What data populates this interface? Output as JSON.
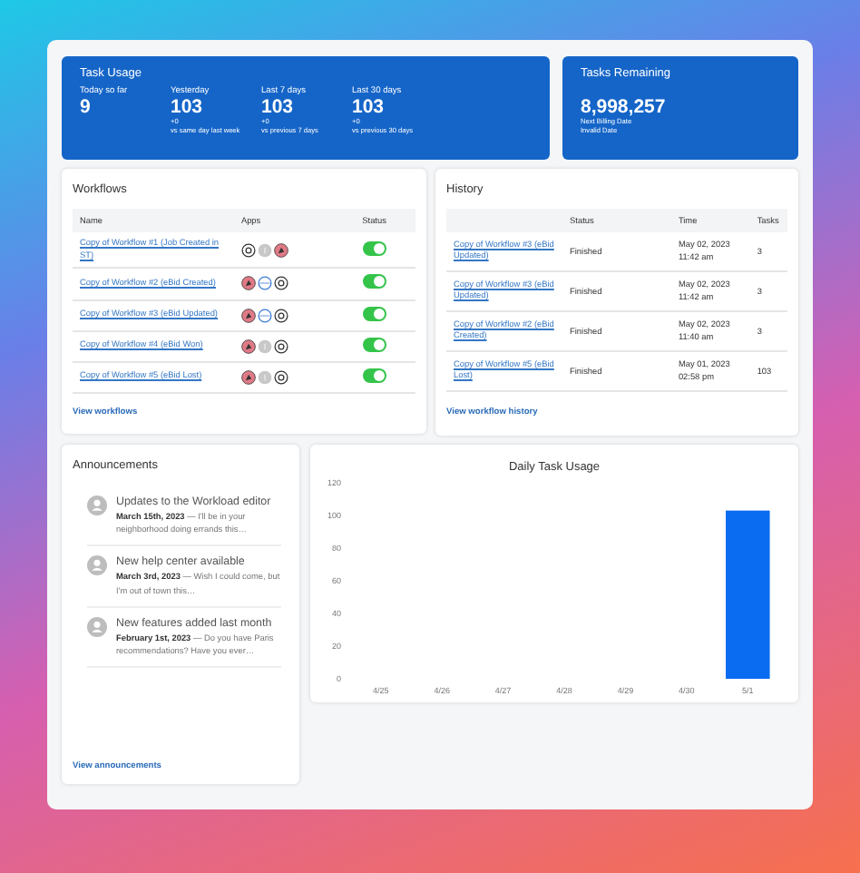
{
  "task_usage": {
    "title": "Task Usage",
    "stats": [
      {
        "label": "Today so far",
        "value": "9"
      },
      {
        "label": "Yesterday",
        "value": "103",
        "change": "+0",
        "compare": "vs same day last week"
      },
      {
        "label": "Last 7 days",
        "value": "103",
        "change": "+0",
        "compare": "vs previous 7 days"
      },
      {
        "label": "Last 30 days",
        "value": "103",
        "change": "+0",
        "compare": "vs previous 30 days"
      }
    ]
  },
  "tasks_remaining": {
    "title": "Tasks Remaining",
    "value": "8,998,257",
    "label": "Next Billing Date",
    "date": "Invalid Date"
  },
  "workflows": {
    "title": "Workflows",
    "columns": [
      "Name",
      "Apps",
      "Status"
    ],
    "rows": [
      {
        "name": "Copy of Workflow #1 (Job Created in ST)",
        "apps": [
          {
            "kind": "mark"
          },
          {
            "kind": "grey"
          },
          {
            "kind": "brand"
          }
        ],
        "on": true
      },
      {
        "name": "Copy of Workflow #2 (eBid Created)",
        "apps": [
          {
            "kind": "brand"
          },
          {
            "kind": "ring"
          },
          {
            "kind": "mark"
          }
        ],
        "on": true
      },
      {
        "name": "Copy of Workflow #3 (eBid Updated)",
        "apps": [
          {
            "kind": "brand"
          },
          {
            "kind": "ring"
          },
          {
            "kind": "mark"
          }
        ],
        "on": true
      },
      {
        "name": "Copy of Workflow #4 (eBid Won)",
        "apps": [
          {
            "kind": "brand"
          },
          {
            "kind": "grey"
          },
          {
            "kind": "mark"
          }
        ],
        "on": true
      },
      {
        "name": "Copy of Workflow #5 (eBid Lost)",
        "apps": [
          {
            "kind": "brand"
          },
          {
            "kind": "grey"
          },
          {
            "kind": "mark"
          }
        ],
        "on": true
      }
    ],
    "link": "View workflows"
  },
  "history": {
    "title": "History",
    "columns": [
      "Status",
      "Time",
      "Tasks"
    ],
    "rows": [
      {
        "name": "Copy of Workflow #3 (eBid Updated)",
        "status": "Finished",
        "time": "May 02, 2023 11:42 am",
        "tasks": "3"
      },
      {
        "name": "Copy of Workflow #3 (eBid Updated)",
        "status": "Finished",
        "time": "May 02, 2023 11:42 am",
        "tasks": "3"
      },
      {
        "name": "Copy of Workflow #2 (eBid Created)",
        "status": "Finished",
        "time": "May 02, 2023 11:40 am",
        "tasks": "3"
      },
      {
        "name": "Copy of Workflow #5 (eBid Lost)",
        "status": "Finished",
        "time": "May 01, 2023 02:58 pm",
        "tasks": "103"
      }
    ],
    "link": "View workflow history"
  },
  "announcements": {
    "title": "Announcements",
    "items": [
      {
        "title": "Updates to the Workload editor",
        "text": "**March 15th, 2023** — I'll be in your neighborhood doing errands this…"
      },
      {
        "title": "New help center available",
        "text": "**March 3rd, 2023** — Wish I could come, but I'm out of town this…"
      },
      {
        "title": "New features added last month",
        "text": "**February 1st, 2023** — Do you have Paris recommendations? Have you ever…"
      }
    ],
    "link": "View announcements"
  },
  "daily_usage": {
    "chart_data": {
      "type": "bar",
      "title": "Daily Task Usage",
      "categories": [
        "4/25",
        "4/26",
        "4/27",
        "4/28",
        "4/29",
        "4/30",
        "5/1"
      ],
      "series": [
        {
          "color": "#0a6cf0",
          "values": [
            0,
            0,
            0,
            0,
            0,
            0,
            103
          ]
        }
      ],
      "ylim": [
        0,
        120
      ],
      "yticks": [
        0,
        20,
        40,
        60,
        80,
        100,
        120
      ]
    }
  }
}
